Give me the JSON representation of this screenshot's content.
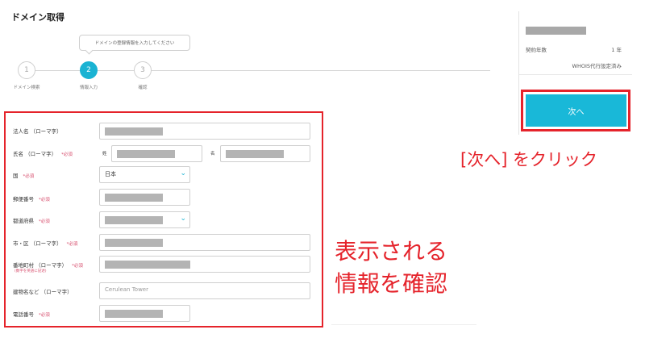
{
  "page": {
    "title": "ドメイン取得"
  },
  "stepper": {
    "tooltip": "ドメインの登録情報を入力してください",
    "steps": [
      {
        "number": "1",
        "label": "ドメイン検索"
      },
      {
        "number": "2",
        "label": "情報入力"
      },
      {
        "number": "3",
        "label": "確認"
      }
    ],
    "active_step": 2
  },
  "summary_card": {
    "contract_label": "契約年数",
    "contract_value": "1 年",
    "whois_text": "WHOIS代行設定済み",
    "next_button": "次へ"
  },
  "form": {
    "required_text": "*必須",
    "fields": {
      "corp_name": {
        "label": "法人名 （ローマ字）"
      },
      "full_name": {
        "label": "氏名 （ローマ字）",
        "surname_label": "姓",
        "given_label": "名"
      },
      "country": {
        "label": "国",
        "value": "日本"
      },
      "postal_code": {
        "label": "郵便番号"
      },
      "prefecture": {
        "label": "都道府県"
      },
      "city": {
        "label": "市・区 （ローマ字）"
      },
      "street": {
        "label": "番地町村 （ローマ字）",
        "note": "(数字を英語に記述)"
      },
      "building": {
        "label": "建物名など （ローマ字）",
        "value": "Cerulean Tower"
      },
      "phone": {
        "label": "電話番号"
      }
    }
  },
  "annotations": {
    "click_next": "[次へ] をクリック",
    "confirm_line1": "表示される",
    "confirm_line2": "情報を確認"
  },
  "colors": {
    "accent": "#1ab3d3",
    "highlight": "#e5232b",
    "required": "#d64a6a"
  }
}
